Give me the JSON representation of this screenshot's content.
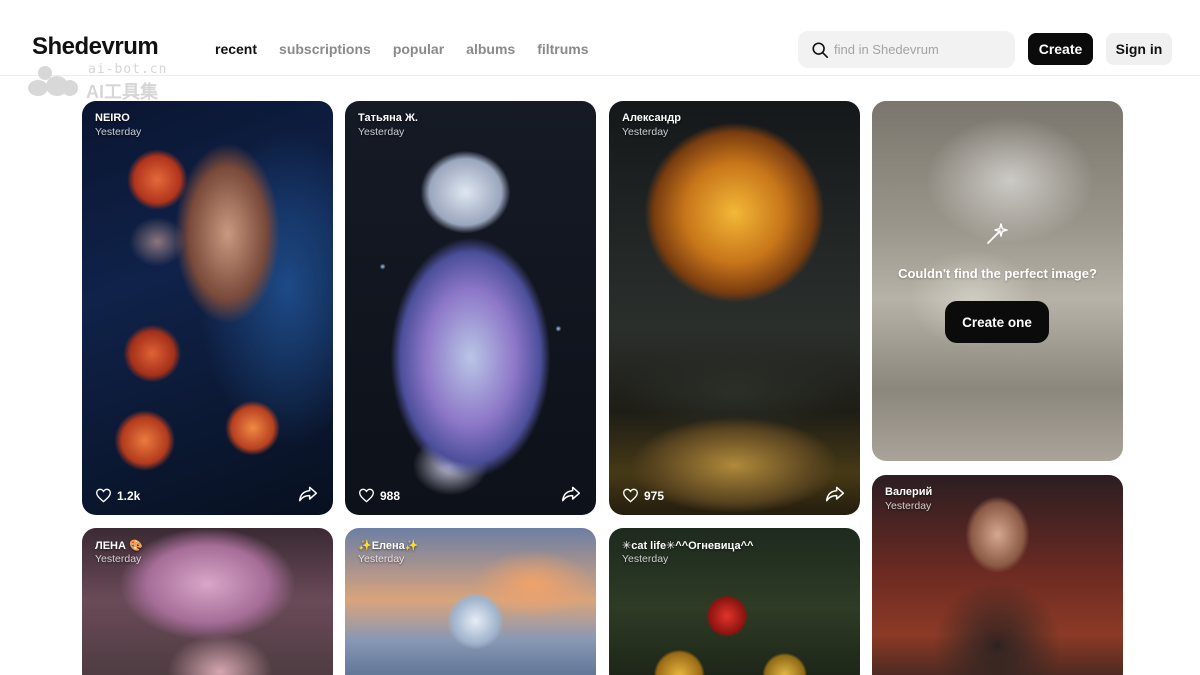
{
  "header": {
    "logo": "Shedevrum",
    "nav": [
      {
        "label": "recent",
        "active": true
      },
      {
        "label": "subscriptions"
      },
      {
        "label": "popular"
      },
      {
        "label": "albums"
      },
      {
        "label": "filtrums"
      }
    ],
    "search_placeholder": "find in Shedevrum",
    "create_label": "Create",
    "signin_label": "Sign in"
  },
  "watermark": {
    "line1": "ai-bot.cn",
    "line2": "AI工具集"
  },
  "cards": [
    {
      "author": "NEIRO",
      "time": "Yesterday",
      "likes": "1.2k"
    },
    {
      "author": "Татьяна Ж.",
      "time": "Yesterday",
      "likes": "988"
    },
    {
      "author": "Александр",
      "time": "Yesterday",
      "likes": "975"
    },
    {
      "author": "ЛЕНА 🎨",
      "time": "Yesterday"
    },
    {
      "author": "✨Елена✨",
      "time": "Yesterday"
    },
    {
      "author": "✳cat life✳^^Огневица^^",
      "time": "Yesterday"
    },
    {
      "author": "Валерий",
      "time": "Yesterday"
    }
  ],
  "cta": {
    "message": "Couldn't find the perfect image?",
    "button_label": "Create one"
  },
  "colors": {
    "primary_button": "#0b0b0b",
    "nav_inactive": "#8a8a8a",
    "search_bg": "#f2f2f2"
  }
}
